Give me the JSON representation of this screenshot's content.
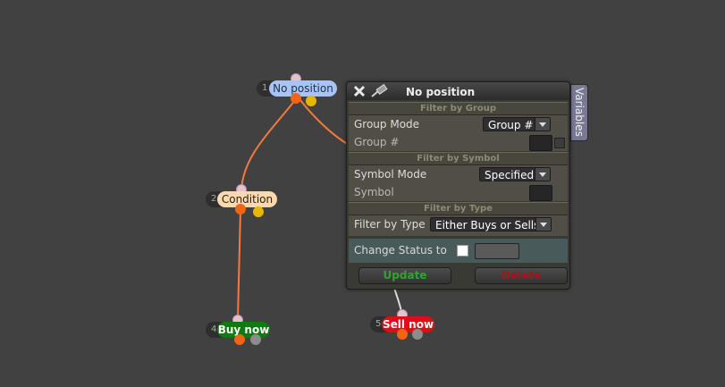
{
  "nodes": [
    {
      "number": "1",
      "label": "No position",
      "label_bg": "#a8c4f6",
      "label_color": "#1f3048"
    },
    {
      "number": "2",
      "label": "Condition",
      "label_bg": "#fbd8ae",
      "label_color": "#2a1e10"
    },
    {
      "number": "4",
      "label": "Buy now",
      "label_bg": "#0e7a10",
      "label_color": "#ffffff"
    },
    {
      "number": "5",
      "label": "Sell now",
      "label_bg": "#e40c14",
      "label_color": "#ffffff"
    }
  ],
  "panel": {
    "title": "No position",
    "side_tab": "Variables",
    "sections": [
      {
        "title": "Filter by Group",
        "fields": [
          {
            "label": "Group Mode",
            "type": "select",
            "value": "Group #"
          },
          {
            "label": "Group #",
            "type": "input",
            "value": ""
          }
        ]
      },
      {
        "title": "Filter by Symbol",
        "fields": [
          {
            "label": "Symbol Mode",
            "type": "select",
            "value": "Specified"
          },
          {
            "label": "Symbol",
            "type": "input",
            "value": ""
          }
        ]
      },
      {
        "title": "Filter by Type",
        "fields": [
          {
            "label": "Filter by Type",
            "type": "select",
            "value": "Either Buys or Sells"
          }
        ]
      }
    ],
    "change_status": {
      "label": "Change Status to",
      "checked": false,
      "value": ""
    },
    "update_button": "Update",
    "delete_button": "Delete",
    "colors": {
      "update": "#2ea62e",
      "delete": "#a01818",
      "accent_edge": "#f07a3a"
    }
  }
}
